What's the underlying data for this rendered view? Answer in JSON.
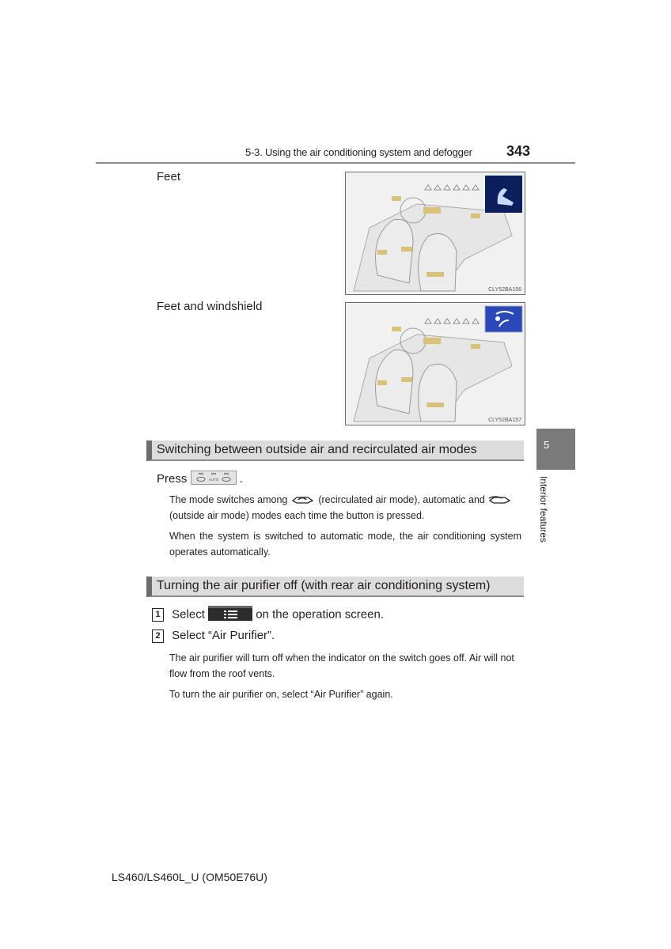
{
  "header": {
    "section_title": "5-3. Using the air conditioning system and defogger",
    "page_number": "343"
  },
  "figures": [
    {
      "label": "Feet",
      "code": "CLY52BA156",
      "mode_icon": "feet-mode-icon"
    },
    {
      "label": "Feet and windshield",
      "code": "CLY52BA157",
      "mode_icon": "feet-windshield-mode-icon"
    }
  ],
  "side_tab": {
    "chapter_number": "5",
    "chapter_title": "Interior features"
  },
  "sections": [
    {
      "title": "Switching between outside air and recirculated air modes",
      "press_prefix": "Press",
      "press_suffix": ".",
      "button_label": "AUTO",
      "para1_a": "The mode switches among",
      "para1_b": "(recirculated air mode), automatic and",
      "para1_c": "(outside air mode) modes each time the button is pressed.",
      "para2": "When the system is switched to automatic mode, the air conditioning system operates automatically."
    },
    {
      "title": "Turning the air purifier off (with rear air conditioning system)",
      "steps": [
        {
          "num": "1",
          "prefix": "Select",
          "suffix": "on the operation screen."
        },
        {
          "num": "2",
          "text": "Select “Air Purifier”."
        }
      ],
      "para1": "The air purifier will turn off when the indicator on the switch goes off. Air will not flow from the roof vents.",
      "para2": "To turn the air purifier on, select “Air Purifier” again."
    }
  ],
  "footer": {
    "model": "LS460/LS460L_U (OM50E76U)"
  }
}
